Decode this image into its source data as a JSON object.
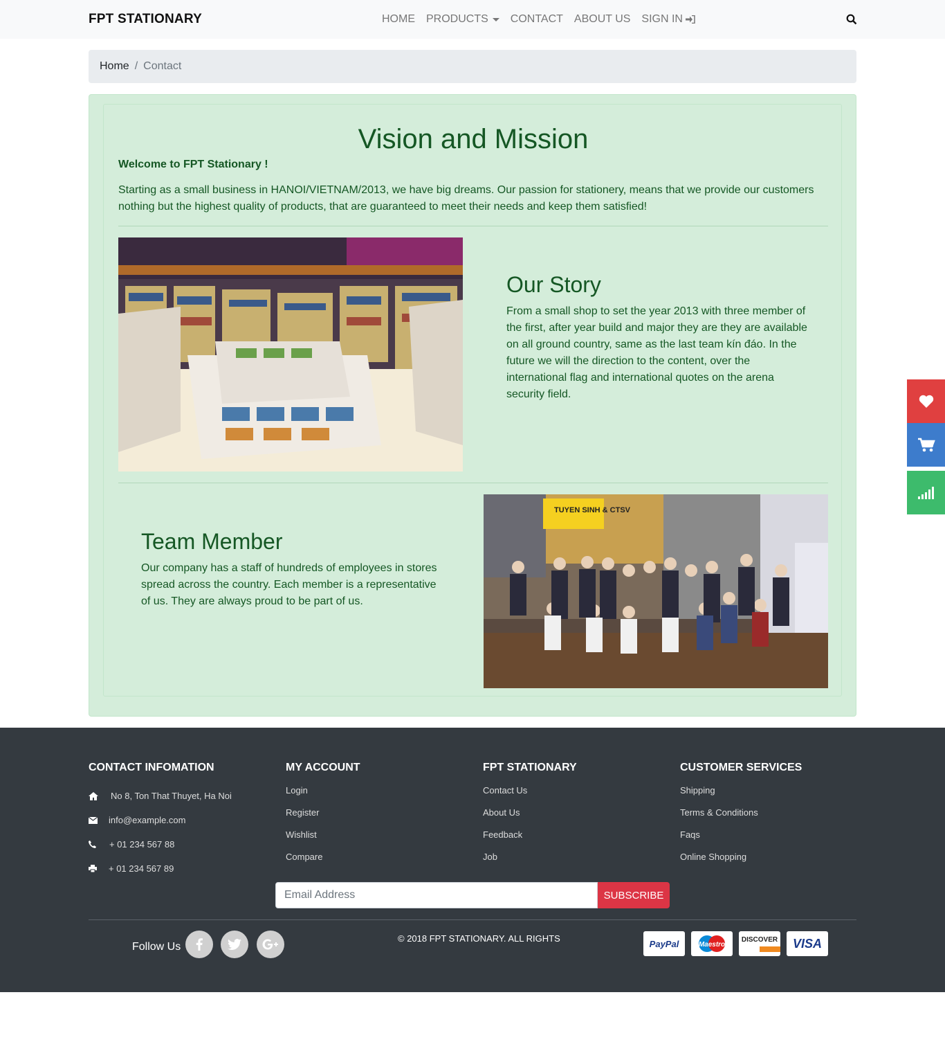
{
  "nav": {
    "brand": "FPT STATIONARY",
    "items": [
      "HOME",
      "PRODUCTS",
      "CONTACT",
      "ABOUT US",
      "SIGN IN"
    ]
  },
  "breadcrumb": {
    "home": "Home",
    "separator": "/",
    "current": "Contact"
  },
  "main": {
    "title": "Vision and Mission",
    "welcome": "Welcome to FPT Stationary !",
    "intro": "Starting as a small business in HANOI/VIETNAM/2013, we have big dreams. Our passion for stationery, means that we provide our customers nothing but the highest quality of products, that are guaranteed to meet their needs and keep them satisfied!",
    "story": {
      "heading": "Our Story",
      "text": "From a small shop to set the year 2013 with three member of the first, after year build and major they are they are available on all ground country, same as the last team kín đáo. In the future we will the direction to the content, over the international flag and international quotes on the arena security field."
    },
    "team": {
      "heading": "Team Member",
      "text": "Our company has a staff of hundreds of employees in stores spread across the country. Each member is a representative of us. They are always proud to be part of us."
    },
    "team_photo_banner": "TUYEN SINH & CTSV"
  },
  "footer": {
    "contact": {
      "heading": "CONTACT INFOMATION",
      "address": "No 8, Ton That Thuyet, Ha Noi",
      "email": "info@example.com",
      "phone": "+ 01 234 567 88",
      "fax": "+ 01 234 567 89"
    },
    "account": {
      "heading": "MY ACCOUNT",
      "links": [
        "Login",
        "Register",
        "Wishlist",
        "Compare"
      ]
    },
    "company": {
      "heading": "FPT STATIONARY",
      "links": [
        "Contact Us",
        "About Us",
        "Feedback",
        "Job"
      ]
    },
    "services": {
      "heading": "CUSTOMER SERVICES",
      "links": [
        "Shipping",
        "Terms & Conditions",
        "Faqs",
        "Online Shopping"
      ]
    },
    "subscribe": {
      "placeholder": "Email Address",
      "button": "SUBSCRIBE"
    },
    "follow": "Follow Us",
    "copyright": "© 2018 FPT STATIONARY. ALL RIGHTS",
    "payments": [
      "PayPal",
      "Maestro",
      "DISCOVER",
      "VISA"
    ]
  },
  "colors": {
    "accent_green": "#155724",
    "card_bg": "#d4edda",
    "footer_bg": "#343a40",
    "subscribe_red": "#dc3545",
    "wishlist_red": "#e04040",
    "cart_blue": "#3d7ccc",
    "compare_green": "#3dbb6c"
  }
}
